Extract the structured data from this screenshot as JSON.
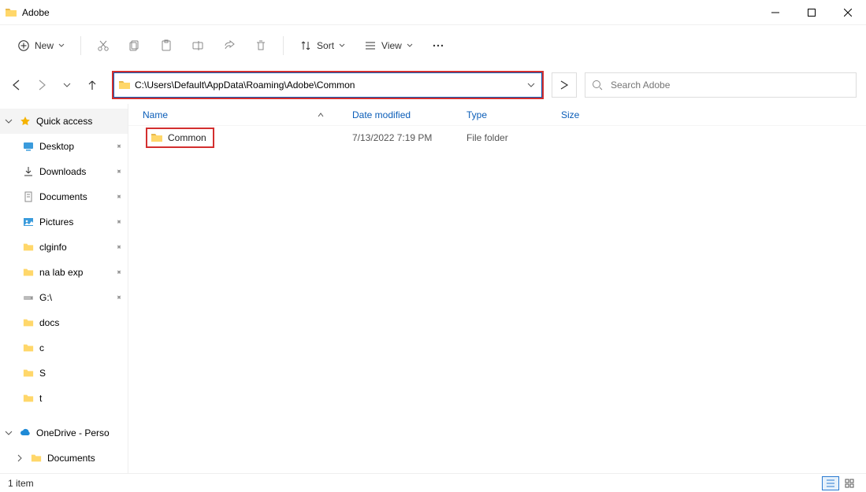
{
  "window": {
    "title": "Adobe"
  },
  "toolbar": {
    "new_label": "New",
    "sort_label": "Sort",
    "view_label": "View"
  },
  "address": {
    "path": "C:\\Users\\Default\\AppData\\Roaming\\Adobe\\Common"
  },
  "search": {
    "placeholder": "Search Adobe"
  },
  "sidebar": {
    "quick_access": "Quick access",
    "items": [
      {
        "label": "Desktop"
      },
      {
        "label": "Downloads"
      },
      {
        "label": "Documents"
      },
      {
        "label": "Pictures"
      },
      {
        "label": "clginfo"
      },
      {
        "label": "na lab exp"
      },
      {
        "label": "G:\\"
      },
      {
        "label": "docs"
      },
      {
        "label": "c"
      },
      {
        "label": "S"
      },
      {
        "label": "t"
      }
    ],
    "onedrive": "OneDrive - Perso",
    "documents": "Documents"
  },
  "columns": {
    "name": "Name",
    "date": "Date modified",
    "type": "Type",
    "size": "Size"
  },
  "rows": [
    {
      "name": "Common",
      "date": "7/13/2022 7:19 PM",
      "type": "File folder",
      "size": ""
    }
  ],
  "status": {
    "count": "1 item"
  }
}
